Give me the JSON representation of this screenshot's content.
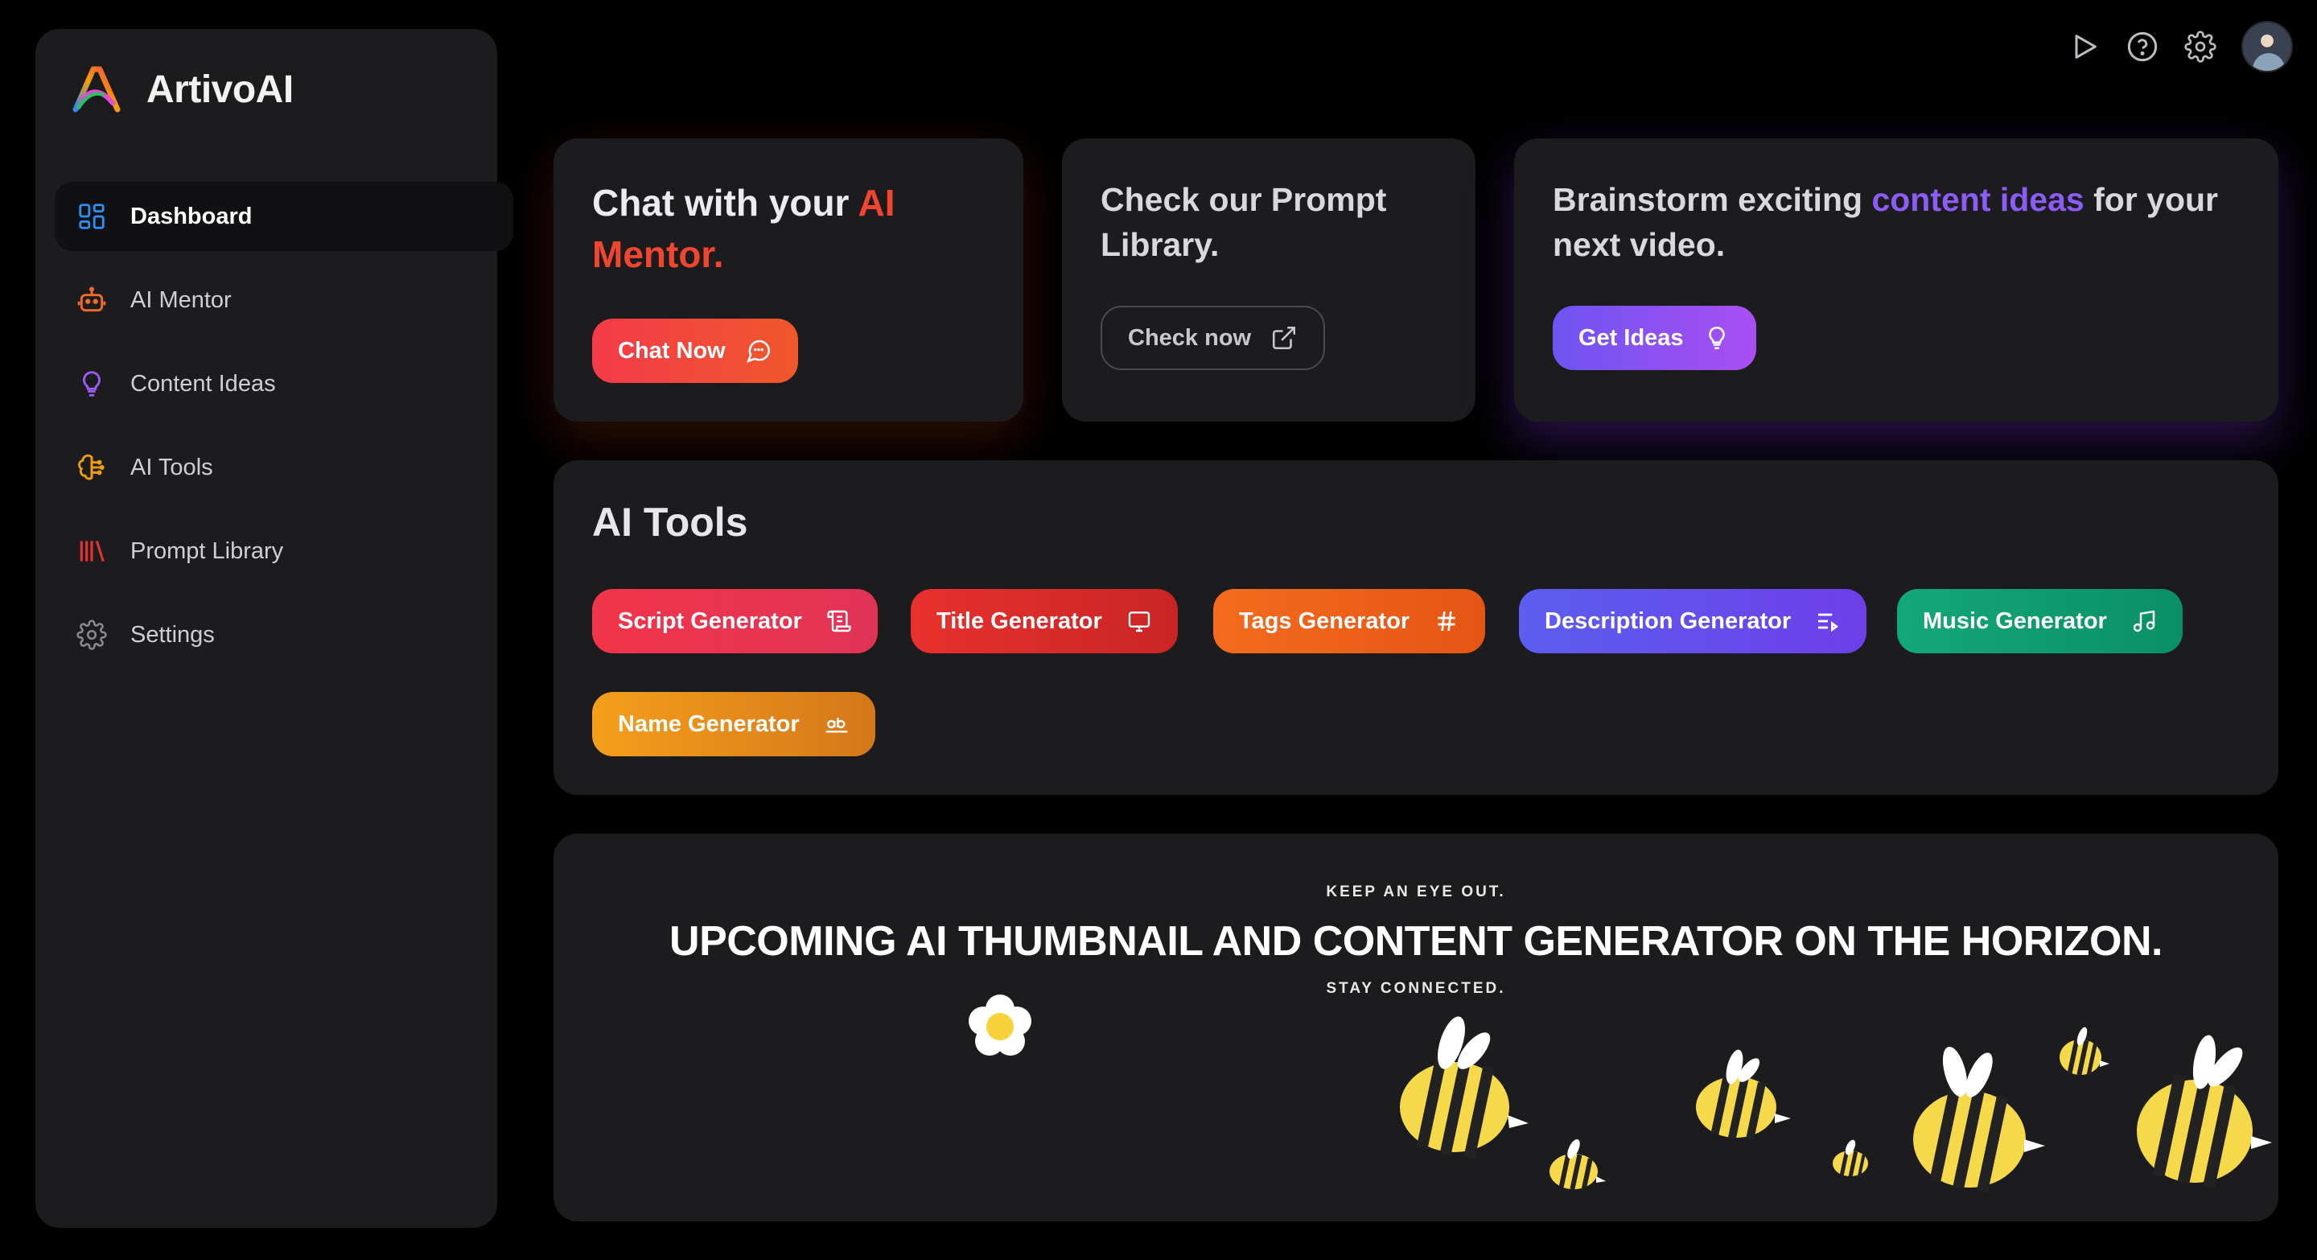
{
  "brand": {
    "name": "ArtivoAI"
  },
  "sidebar": {
    "items": [
      {
        "label": "Dashboard",
        "icon": "dashboard-grid-icon",
        "active": true
      },
      {
        "label": "AI Mentor",
        "icon": "robot-icon"
      },
      {
        "label": "Content Ideas",
        "icon": "lightbulb-icon"
      },
      {
        "label": "AI Tools",
        "icon": "brain-circuit-icon"
      },
      {
        "label": "Prompt Library",
        "icon": "library-icon"
      },
      {
        "label": "Settings",
        "icon": "gear-icon"
      }
    ]
  },
  "topbar": {
    "icons": [
      "play-icon",
      "help-circle-icon",
      "gear-icon",
      "avatar"
    ]
  },
  "cards": {
    "chat": {
      "title_pre": "Chat with your ",
      "title_highlight": "AI Mentor.",
      "button": "Chat Now",
      "button_icon": "message-circle-icon"
    },
    "prompt": {
      "title": "Check our Prompt Library.",
      "button": "Check now",
      "button_icon": "external-link-icon"
    },
    "ideas": {
      "title_pre": "Brainstorm exciting ",
      "title_highlight": "content ideas",
      "title_post": " for your next video.",
      "button": "Get Ideas",
      "button_icon": "lightbulb-icon"
    }
  },
  "tools": {
    "title": "AI Tools",
    "items": [
      {
        "label": "Script Generator",
        "icon": "scroll-icon"
      },
      {
        "label": "Title Generator",
        "icon": "monitor-icon"
      },
      {
        "label": "Tags Generator",
        "icon": "hash-icon"
      },
      {
        "label": "Description Generator",
        "icon": "list-arrow-icon"
      },
      {
        "label": "Music Generator",
        "icon": "music-note-icon"
      },
      {
        "label": "Name Generator",
        "icon": "text-ab-icon"
      }
    ]
  },
  "banner": {
    "kicker": "KEEP AN EYE OUT.",
    "headline": "UPCOMING AI THUMBNAIL AND CONTENT GENERATOR ON THE HORIZON.",
    "sub": "STAY CONNECTED."
  },
  "colors": {
    "accent_red": "#f0452e",
    "accent_purple": "#8b5cf6",
    "card_bg": "#1c1c1e",
    "page_bg": "#000000"
  }
}
